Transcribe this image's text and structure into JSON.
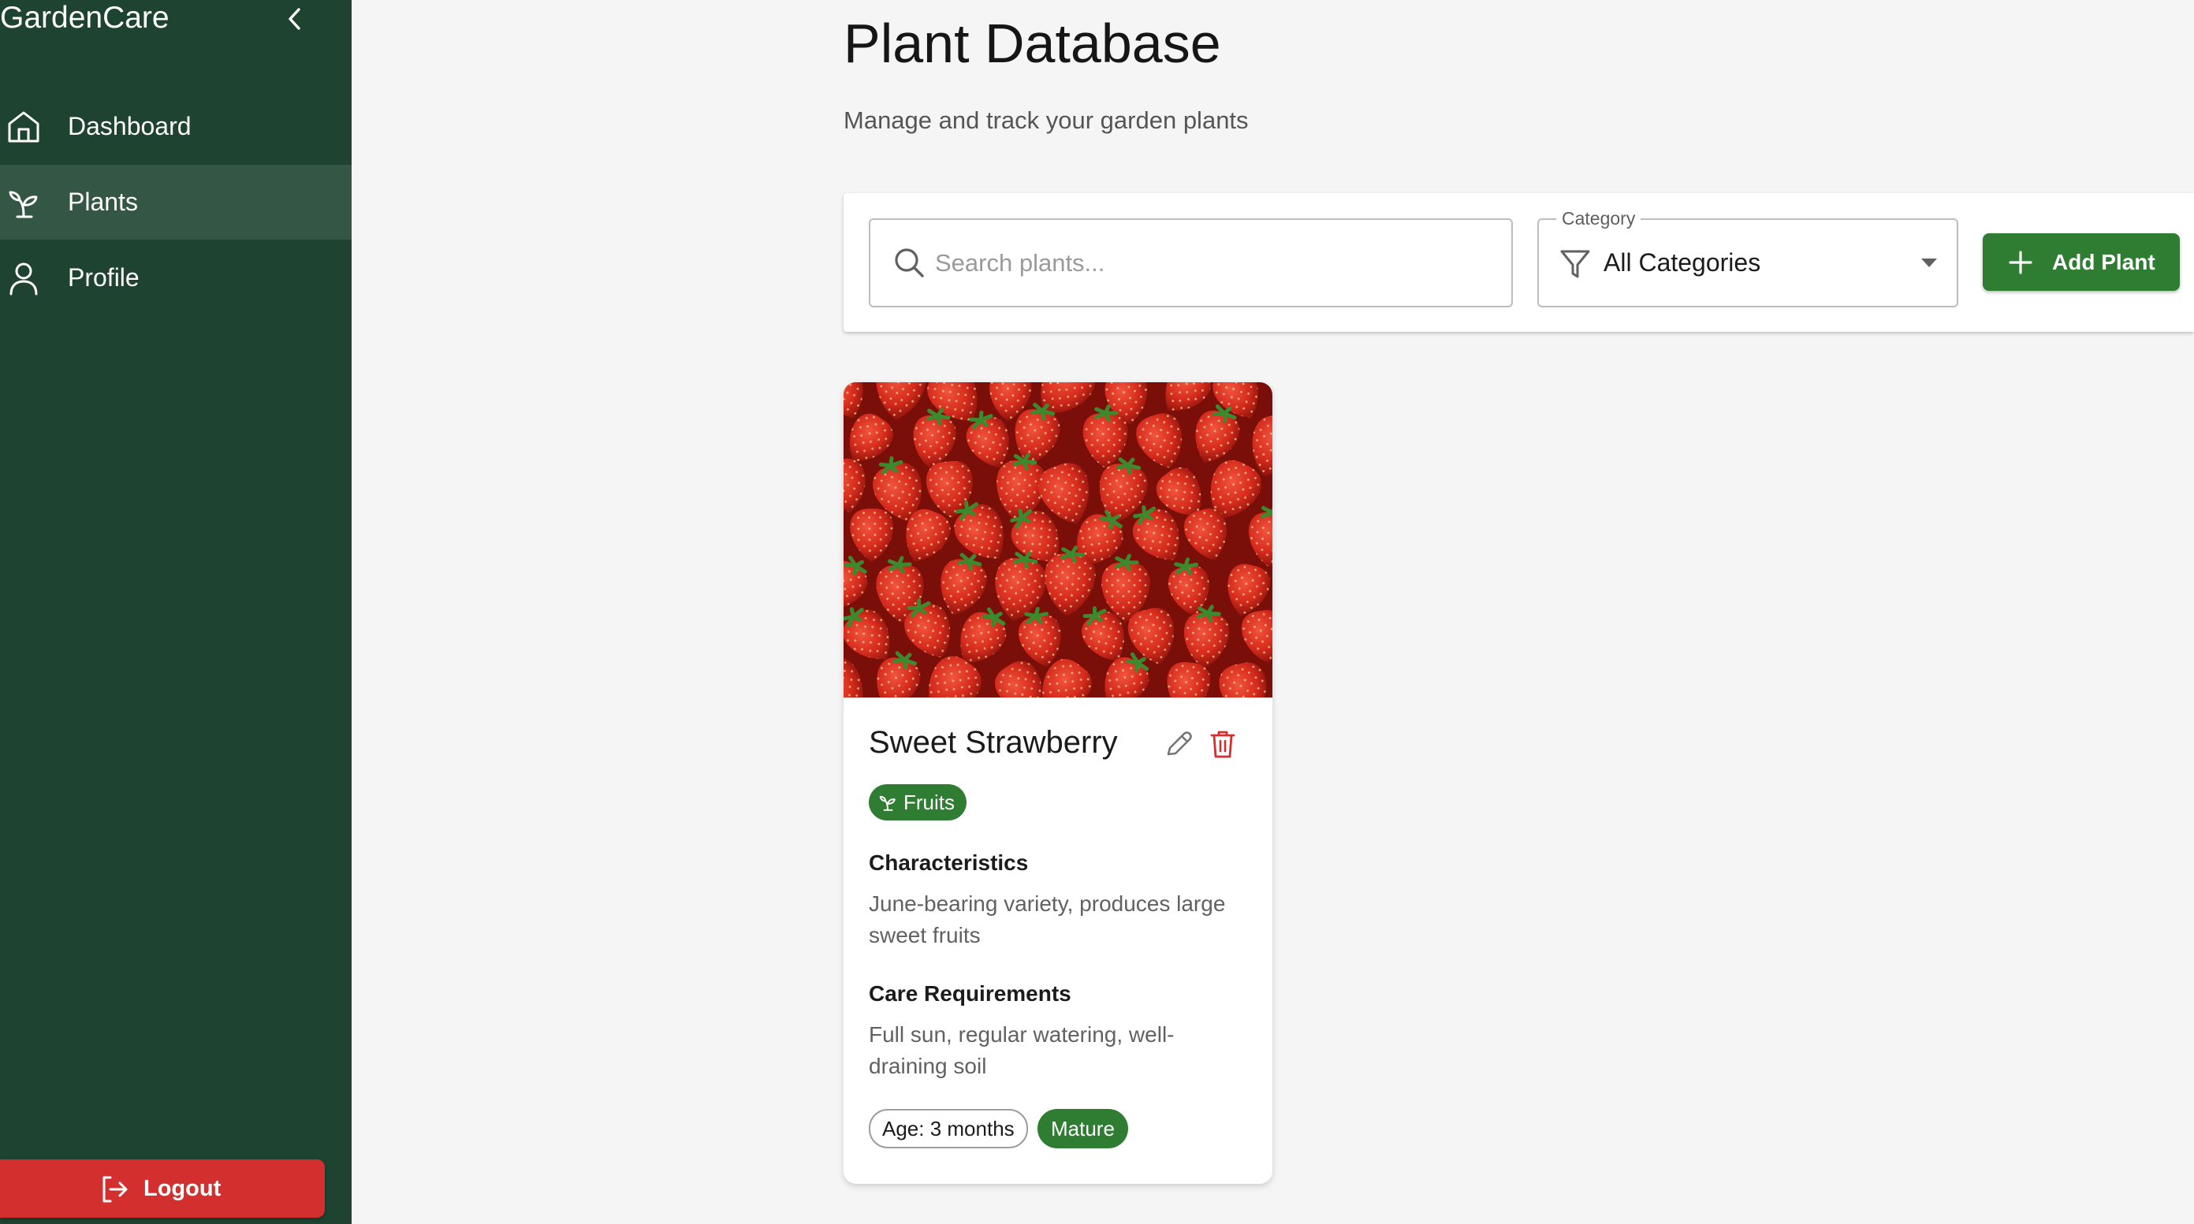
{
  "app": {
    "name": "GardenCare",
    "collapse_icon": "chevron-left-icon"
  },
  "sidebar": {
    "items": [
      {
        "label": "Dashboard",
        "icon": "home-icon",
        "active": false
      },
      {
        "label": "Plants",
        "icon": "sprout-icon",
        "active": true
      },
      {
        "label": "Profile",
        "icon": "user-icon",
        "active": false
      }
    ],
    "logout": {
      "label": "Logout",
      "icon": "logout-icon",
      "color": "#d32f2f"
    }
  },
  "header": {
    "title": "Plant Database",
    "subtitle": "Manage and track your garden plants"
  },
  "toolbar": {
    "search": {
      "placeholder": "Search plants...",
      "value": "",
      "icon": "search-icon"
    },
    "category": {
      "label": "Category",
      "value": "All Categories",
      "icon": "filter-icon"
    },
    "add_button": {
      "label": "Add Plant",
      "icon": "plus-icon"
    }
  },
  "plants": [
    {
      "name": "Sweet Strawberry",
      "image": "strawberries-photo",
      "category": "Fruits",
      "characteristics_heading": "Characteristics",
      "characteristics": "June-bearing variety, produces large sweet fruits",
      "care_heading": "Care Requirements",
      "care": "Full sun, regular watering, well-draining soil",
      "age": "Age: 3 months",
      "stage": "Mature"
    }
  ],
  "colors": {
    "sidebar_bg": "#1e4330",
    "accent": "#2e7d32",
    "danger": "#d32f2f",
    "page_bg": "#f5f5f5"
  }
}
